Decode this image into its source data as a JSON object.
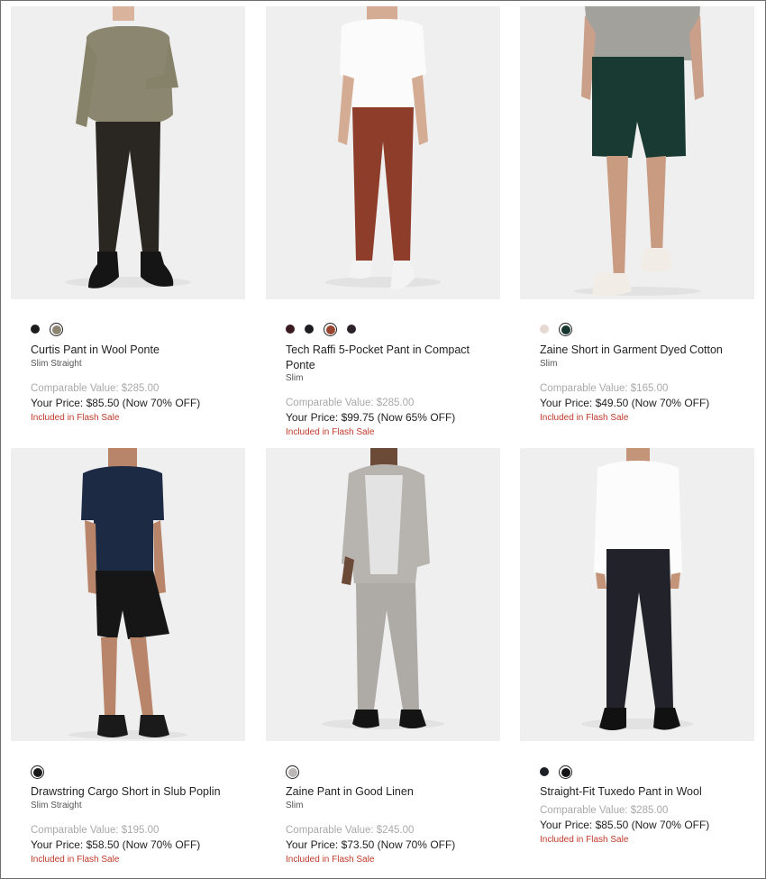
{
  "products": [
    {
      "name": "Curtis Pant in Wool Ponte",
      "fit": "Slim Straight",
      "comparable": "Comparable Value: $285.00",
      "price": "Your Price: $85.50 (Now 70% OFF)",
      "flash": "Included in Flash Sale",
      "swatches": [
        {
          "color": "#1c1c1c",
          "selected": false
        },
        {
          "color": "#8b8571",
          "selected": true
        }
      ]
    },
    {
      "name": "Tech Raffi 5-Pocket Pant in Compact Ponte",
      "fit": "Slim",
      "comparable": "Comparable Value: $285.00",
      "price": "Your Price: $99.75 (Now 65% OFF)",
      "flash": "Included in Flash Sale",
      "swatches": [
        {
          "color": "#3a1a1e",
          "selected": false
        },
        {
          "color": "#1e1e22",
          "selected": false
        },
        {
          "color": "#9a4531",
          "selected": true
        },
        {
          "color": "#2a2228",
          "selected": false
        }
      ]
    },
    {
      "name": "Zaine Short in Garment Dyed Cotton",
      "fit": "Slim",
      "comparable": "Comparable Value: $165.00",
      "price": "Your Price: $49.50 (Now 70% OFF)",
      "flash": "Included in Flash Sale",
      "swatches": [
        {
          "color": "#e6d9d2",
          "selected": false
        },
        {
          "color": "#15352e",
          "selected": true
        }
      ]
    },
    {
      "name": "Drawstring Cargo Short in Slub Poplin",
      "fit": "Slim Straight",
      "comparable": "Comparable Value: $195.00",
      "price": "Your Price: $58.50 (Now 70% OFF)",
      "flash": "Included in Flash Sale",
      "swatches": [
        {
          "color": "#1b1b1b",
          "selected": true
        }
      ]
    },
    {
      "name": "Zaine Pant in Good Linen",
      "fit": "Slim",
      "comparable": "Comparable Value: $245.00",
      "price": "Your Price: $73.50 (Now 70% OFF)",
      "flash": "Included in Flash Sale",
      "swatches": [
        {
          "color": "#b9b6b3",
          "selected": true
        }
      ]
    },
    {
      "name": "Straight-Fit Tuxedo Pant in Wool",
      "fit": "",
      "comparable": "Comparable Value: $285.00",
      "price": "Your Price: $85.50 (Now 70% OFF)",
      "flash": "Included in Flash Sale",
      "swatches": [
        {
          "color": "#1e1f24",
          "selected": false
        },
        {
          "color": "#141417",
          "selected": true
        }
      ]
    }
  ]
}
